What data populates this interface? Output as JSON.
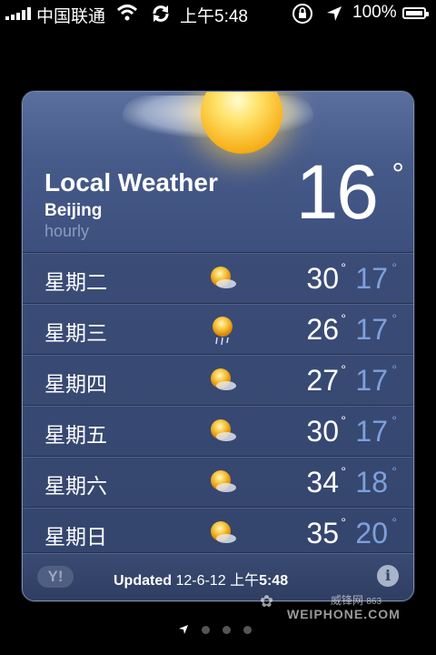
{
  "status_bar": {
    "carrier": "中国联通",
    "time": "上午5:48",
    "battery_percent": "100%",
    "battery_level": 1.0,
    "signal_bars": 5,
    "icons": [
      "signal-icon",
      "wifi-icon",
      "sync-icon",
      "rotation-lock-icon",
      "location-arrow-icon",
      "battery-icon"
    ]
  },
  "weather": {
    "title": "Local Weather",
    "city": "Beijing",
    "mode": "hourly",
    "current_temp": "16",
    "degree": "°",
    "forecast": [
      {
        "day": "星期二",
        "icon": "partly-cloudy-sun-icon",
        "high": "30",
        "low": "17"
      },
      {
        "day": "星期三",
        "icon": "sun-rain-icon",
        "high": "26",
        "low": "17"
      },
      {
        "day": "星期四",
        "icon": "partly-cloudy-sun-icon",
        "high": "27",
        "low": "17"
      },
      {
        "day": "星期五",
        "icon": "partly-cloudy-sun-icon",
        "high": "30",
        "low": "17"
      },
      {
        "day": "星期六",
        "icon": "partly-cloudy-sun-icon",
        "high": "34",
        "low": "18"
      },
      {
        "day": "星期日",
        "icon": "partly-cloudy-sun-icon",
        "high": "35",
        "low": "20"
      }
    ]
  },
  "footer": {
    "yahoo_logo": "Y!",
    "updated_label": "Updated",
    "updated_date": "12-6-12",
    "updated_time_prefix": "上午",
    "updated_time": "5:48",
    "info_icon": "i"
  },
  "watermark": {
    "text_cn": "威锋网",
    "text_tag": "863",
    "brand": "WEIPHONE.COM"
  },
  "pager": {
    "pages": 3,
    "current": 0
  },
  "colors": {
    "low_temp": "#7ea0dc",
    "card_bg": "#3b4d77",
    "sun": "#f7b21c"
  }
}
